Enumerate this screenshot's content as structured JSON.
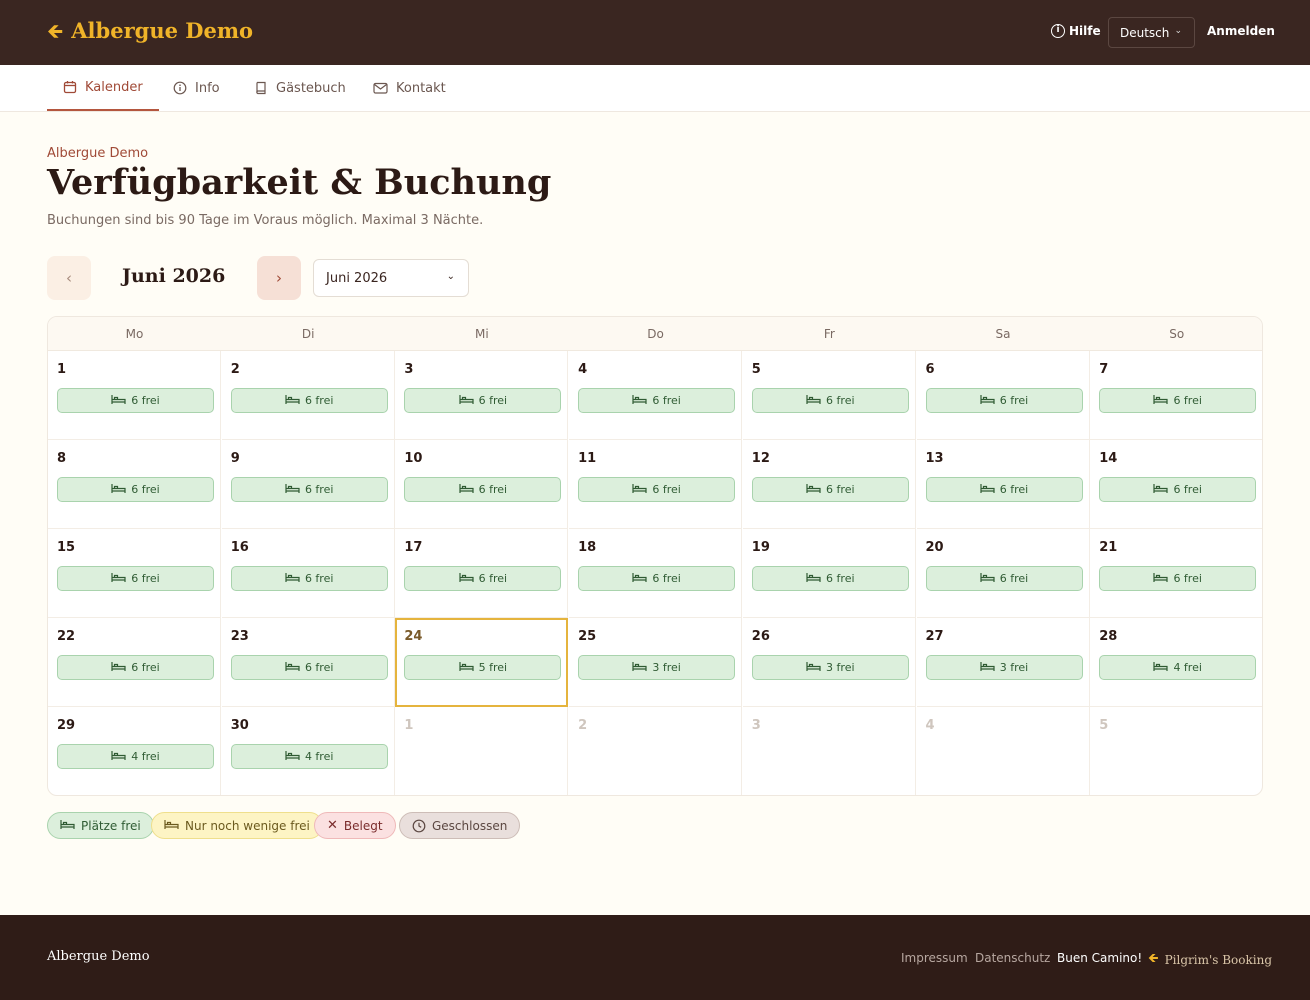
{
  "header": {
    "brand": "Albergue Demo",
    "brand_icon": "scallop-arrow-icon",
    "help_label": "Hilfe",
    "language": "Deutsch",
    "login_label": "Anmelden"
  },
  "nav": {
    "tabs": [
      {
        "label": "Kalender",
        "icon": "calendar-icon",
        "active": true
      },
      {
        "label": "Info",
        "icon": "info-icon",
        "active": false
      },
      {
        "label": "Gästebuch",
        "icon": "book-icon",
        "active": false
      },
      {
        "label": "Kontakt",
        "icon": "mail-icon",
        "active": false
      }
    ]
  },
  "page": {
    "subtitle": "Albergue Demo",
    "title": "Verfügbarkeit & Buchung",
    "description": "Buchungen sind bis 90 Tage im Voraus möglich. Maximal 3 Nächte."
  },
  "calendar": {
    "prev_label": "‹",
    "next_label": "›",
    "month_label": "Juni 2026",
    "month_select": "Juni 2026",
    "weekdays": [
      "Mo",
      "Di",
      "Mi",
      "Do",
      "Fr",
      "Sa",
      "So"
    ],
    "days": [
      {
        "num": "1",
        "avail": "6 frei"
      },
      {
        "num": "2",
        "avail": "6 frei"
      },
      {
        "num": "3",
        "avail": "6 frei"
      },
      {
        "num": "4",
        "avail": "6 frei"
      },
      {
        "num": "5",
        "avail": "6 frei"
      },
      {
        "num": "6",
        "avail": "6 frei"
      },
      {
        "num": "7",
        "avail": "6 frei"
      },
      {
        "num": "8",
        "avail": "6 frei"
      },
      {
        "num": "9",
        "avail": "6 frei"
      },
      {
        "num": "10",
        "avail": "6 frei"
      },
      {
        "num": "11",
        "avail": "6 frei"
      },
      {
        "num": "12",
        "avail": "6 frei"
      },
      {
        "num": "13",
        "avail": "6 frei"
      },
      {
        "num": "14",
        "avail": "6 frei"
      },
      {
        "num": "15",
        "avail": "6 frei"
      },
      {
        "num": "16",
        "avail": "6 frei"
      },
      {
        "num": "17",
        "avail": "6 frei"
      },
      {
        "num": "18",
        "avail": "6 frei"
      },
      {
        "num": "19",
        "avail": "6 frei"
      },
      {
        "num": "20",
        "avail": "6 frei"
      },
      {
        "num": "21",
        "avail": "6 frei"
      },
      {
        "num": "22",
        "avail": "6 frei"
      },
      {
        "num": "23",
        "avail": "6 frei"
      },
      {
        "num": "24",
        "avail": "5 frei",
        "today": true
      },
      {
        "num": "25",
        "avail": "3 frei"
      },
      {
        "num": "26",
        "avail": "3 frei"
      },
      {
        "num": "27",
        "avail": "3 frei"
      },
      {
        "num": "28",
        "avail": "4 frei"
      },
      {
        "num": "29",
        "avail": "4 frei"
      },
      {
        "num": "30",
        "avail": "4 frei"
      },
      {
        "num": "1",
        "other": true
      },
      {
        "num": "2",
        "other": true
      },
      {
        "num": "3",
        "other": true
      },
      {
        "num": "4",
        "other": true
      },
      {
        "num": "5",
        "other": true
      }
    ]
  },
  "legend": {
    "free": "Plätze frei",
    "few": "Nur noch wenige frei",
    "full": "Belegt",
    "closed": "Geschlossen"
  },
  "footer": {
    "brand": "Albergue Demo",
    "impressum": "Impressum",
    "datenschutz": "Datenschutz",
    "camino": "Buen Camino!",
    "powered": "Pilgrim's Booking"
  },
  "colors": {
    "header_bg": "#3a2621",
    "accent": "#a04a37",
    "brand_gold": "#f0b429",
    "free_bg": "#dcefdc",
    "today_border": "#e5b43d",
    "footer_bg": "#2f1c17"
  }
}
